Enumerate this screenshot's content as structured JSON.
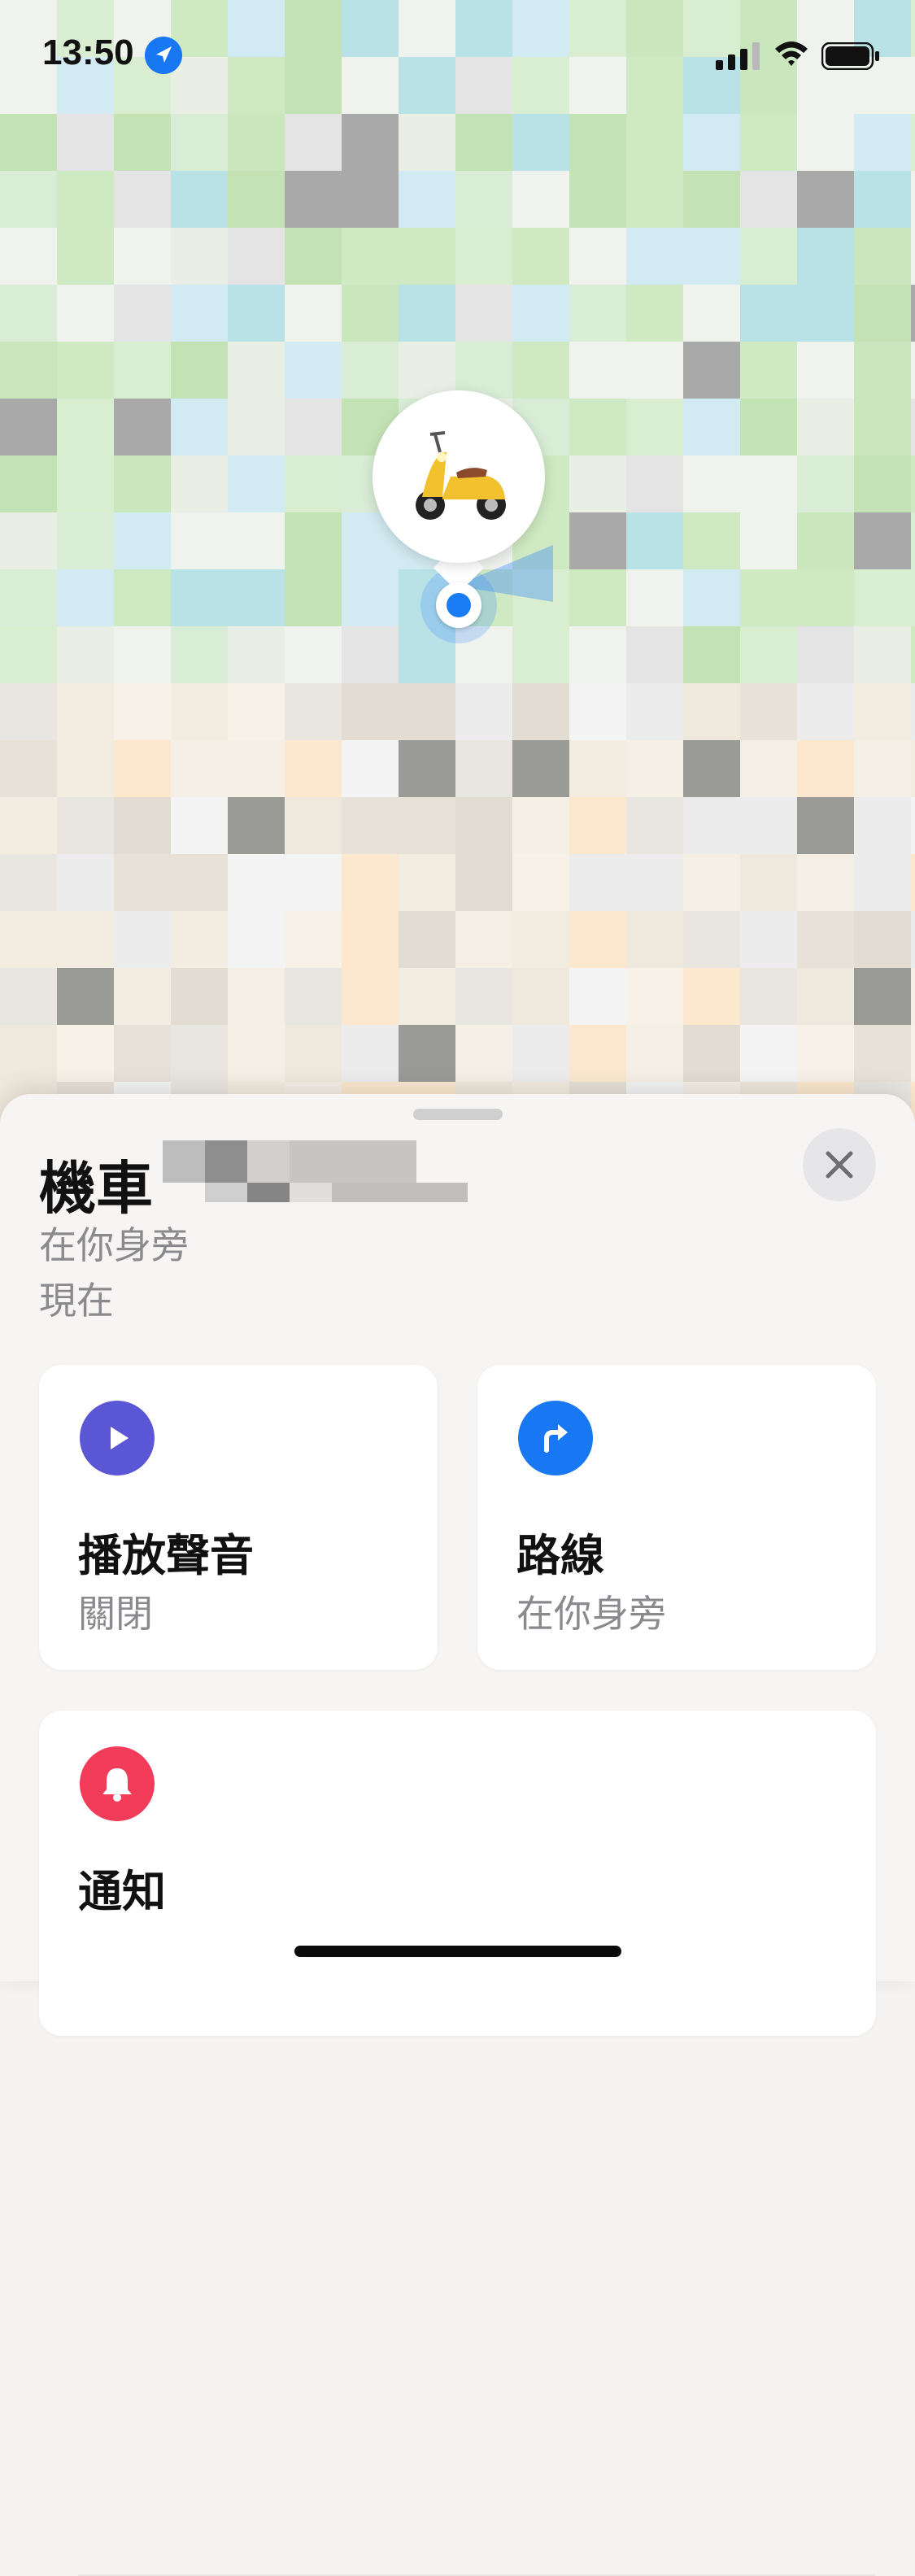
{
  "status_bar": {
    "time": "13:50",
    "location_icon": "location-arrow-icon",
    "signal_icon": "cellular-signal-icon",
    "wifi_icon": "wifi-icon",
    "battery_icon": "battery-icon"
  },
  "map": {
    "pin_icon": "scooter-icon",
    "user_location_icon": "user-location-dot-icon",
    "accent_color": "#1a7cf5"
  },
  "sheet": {
    "title": "機車",
    "subtitle_location": "在你身旁",
    "subtitle_time": "現在",
    "close_icon": "close-icon"
  },
  "actions": {
    "play_sound": {
      "title": "播放聲音",
      "subtitle": "關閉",
      "icon": "play-icon",
      "color": "#5b56d6"
    },
    "directions": {
      "title": "路線",
      "subtitle": "在你身旁",
      "icon": "turn-right-arrow-icon",
      "color": "#1877f2"
    },
    "notifications": {
      "title": "通知",
      "icon": "bell-icon",
      "color": "#f23c5a"
    }
  }
}
